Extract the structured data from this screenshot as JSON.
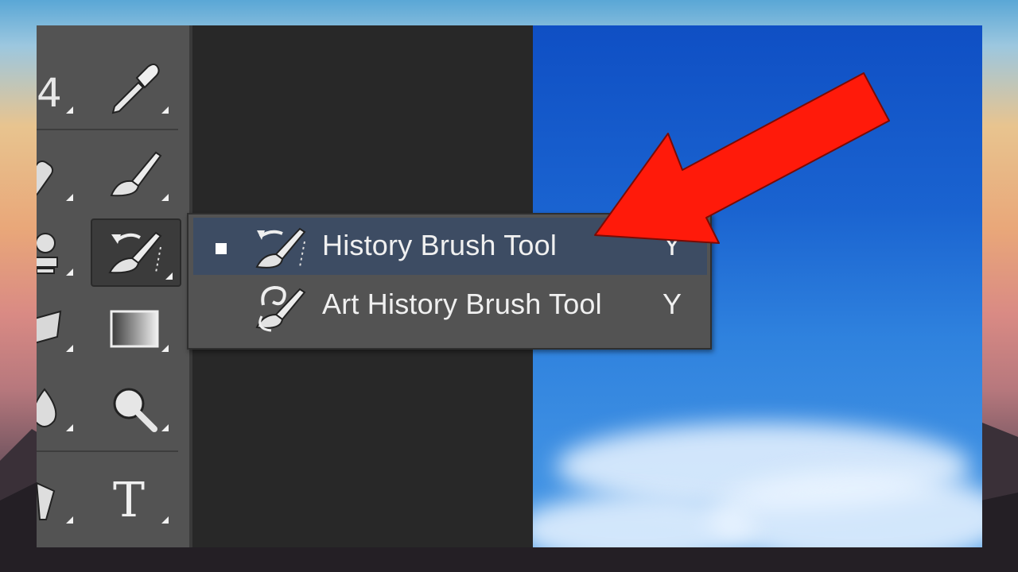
{
  "toolbar": {
    "tools": [
      {
        "name": "crop-tool",
        "icon": "crop-icon"
      },
      {
        "name": "eyedropper-tool",
        "icon": "eyedropper-icon"
      },
      {
        "name": "spot-healing-tool",
        "icon": "bandage-icon"
      },
      {
        "name": "brush-tool",
        "icon": "brush-icon"
      },
      {
        "name": "clone-stamp-tool",
        "icon": "stamp-icon"
      },
      {
        "name": "history-brush-tool",
        "icon": "history-brush-icon",
        "active": true
      },
      {
        "name": "eraser-tool",
        "icon": "eraser-icon"
      },
      {
        "name": "gradient-tool",
        "icon": "gradient-icon"
      },
      {
        "name": "blur-tool",
        "icon": "blur-drop-icon"
      },
      {
        "name": "zoom-tool",
        "icon": "magnifier-icon"
      },
      {
        "name": "pen-tool",
        "icon": "pen-icon"
      },
      {
        "name": "type-tool",
        "icon": "type-icon",
        "glyph": "T"
      }
    ]
  },
  "flyout": {
    "items": [
      {
        "label": "History Brush Tool",
        "shortcut": "Y",
        "selected": true,
        "icon": "history-brush-icon"
      },
      {
        "label": "Art History Brush Tool",
        "shortcut": "Y",
        "selected": false,
        "icon": "art-history-brush-icon"
      }
    ]
  },
  "annotation": {
    "icon": "red-arrow-icon",
    "color": "#ff1a0a"
  },
  "colors": {
    "toolbar_bg": "#535353",
    "selection": "#3d4c63",
    "canvas_dark": "#282828",
    "sky": "#1a63d0"
  }
}
